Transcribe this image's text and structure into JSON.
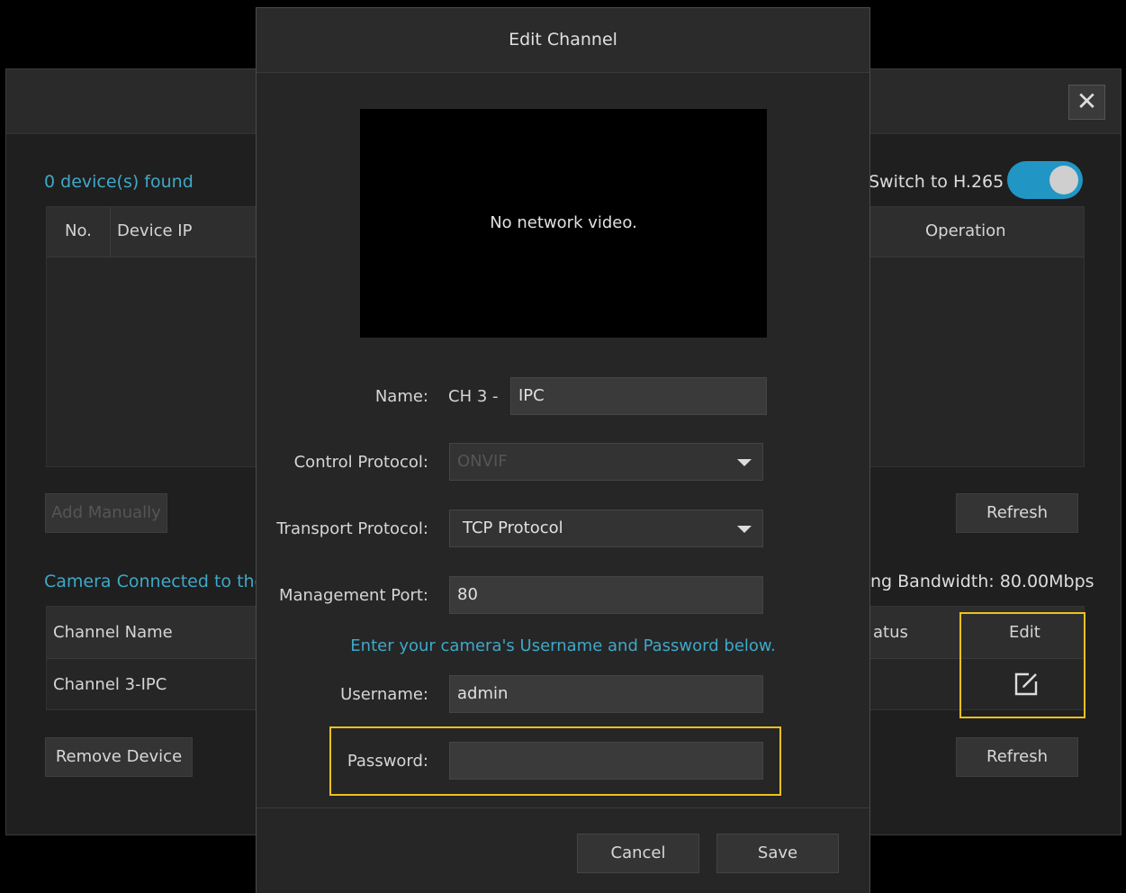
{
  "background": {
    "close_symbol": "✕",
    "found_label": "0 device(s) found",
    "switch_label": "Switch to H.265",
    "switch_on": true,
    "device_table": {
      "columns": [
        "No.",
        "Device IP",
        "Operation"
      ]
    },
    "add_manually_label": "Add Manually",
    "refresh_label_1": "Refresh",
    "camera_connected_label": "Camera Connected to the",
    "bandwidth_label": "ng Bandwidth: 80.00Mbps",
    "channel_table": {
      "columns": [
        "Channel Name",
        "atus",
        "Edit"
      ],
      "rows": [
        {
          "channel_name": "Channel 3-IPC"
        }
      ]
    },
    "remove_device_label": "Remove Device",
    "refresh_label_2": "Refresh"
  },
  "modal": {
    "title": "Edit Channel",
    "video_text": "No network video.",
    "name_label": "Name:",
    "name_prefix": "CH 3 -",
    "name_value": "IPC",
    "control_protocol_label": "Control Protocol:",
    "control_protocol_value": "ONVIF",
    "transport_protocol_label": "Transport Protocol:",
    "transport_protocol_value": "TCP Protocol",
    "management_port_label": "Management Port:",
    "management_port_value": "80",
    "hint": "Enter your camera's Username and Password below.",
    "username_label": "Username:",
    "username_value": "admin",
    "password_label": "Password:",
    "password_value": "",
    "cancel_label": "Cancel",
    "save_label": "Save"
  },
  "colors": {
    "accent": "#3fa8c8",
    "toggle_on": "#2196c4",
    "highlight": "#f0c020"
  }
}
